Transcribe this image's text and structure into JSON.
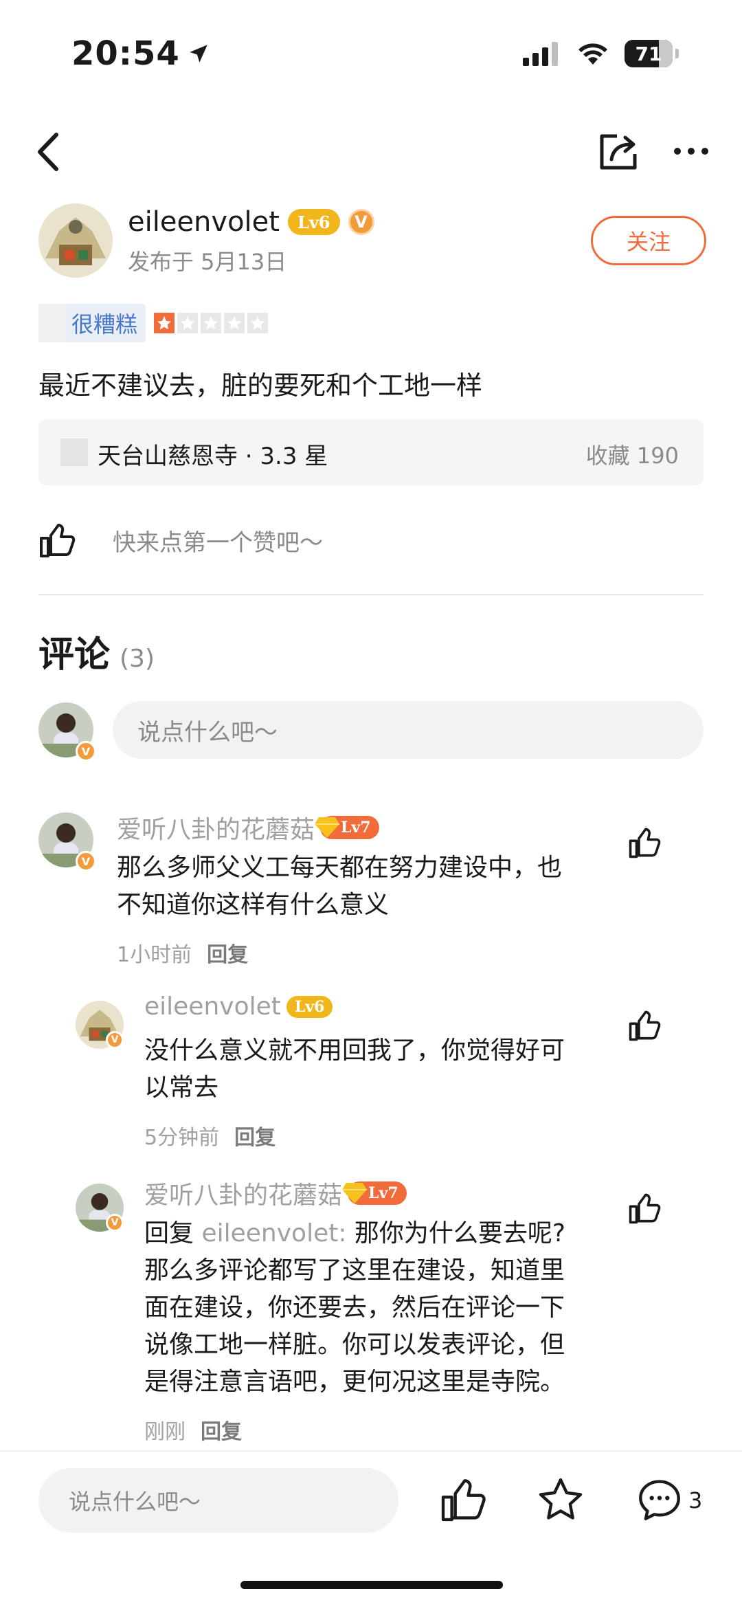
{
  "status_bar": {
    "time": "20:54",
    "battery": "71"
  },
  "post": {
    "author": {
      "name": "eileenvolet",
      "level": "Lv6",
      "verified": "V",
      "date": "发布于 5月13日",
      "follow_label": "关注"
    },
    "rating": {
      "label": "很糟糕",
      "stars": 1,
      "max_stars": 5
    },
    "text": "最近不建议去，脏的要死和个工地一样",
    "poi": {
      "name": "天台山慈恩寺 · 3.3 星",
      "favorites": "收藏 190"
    },
    "like_hint": "快来点第一个赞吧～"
  },
  "comments": {
    "title": "评论",
    "count": "(3)",
    "input_placeholder": "说点什么吧～",
    "items": [
      {
        "name": "爱听八卦的花蘑菇",
        "level": "Lv7",
        "text_line1": "那么多师父义工每天都在努力建设中，也",
        "text_line2": "不知道你这样有什么意义",
        "time": "1小时前",
        "reply_label": "回复"
      },
      {
        "name": "eileenvolet",
        "level": "Lv6",
        "text_line1": "没什么意义就不用回我了，你觉得好可",
        "text_line2": "以常去",
        "time": "5分钟前",
        "reply_label": "回复"
      },
      {
        "name": "爱听八卦的花蘑菇",
        "level": "Lv7",
        "reply_prefix": "回复",
        "reply_target": "eileenvolet:",
        "text_line1": "那你为什么要去呢?",
        "text_line2": "那么多评论都写了这里在建设，知道里",
        "text_line3": "面在建设，你还要去，然后在评论一下",
        "text_line4": "说像工地一样脏。你可以发表评论，但",
        "text_line5": "是得注意言语吧，更何况这里是寺院。",
        "time": "刚刚",
        "reply_label": "回复"
      }
    ]
  },
  "bottom_bar": {
    "input_placeholder": "说点什么吧～",
    "comment_count": "3"
  },
  "colors": {
    "accent": "#f26b3a",
    "level6": "#f2b61d",
    "rating_tag": "#4a78c8"
  }
}
